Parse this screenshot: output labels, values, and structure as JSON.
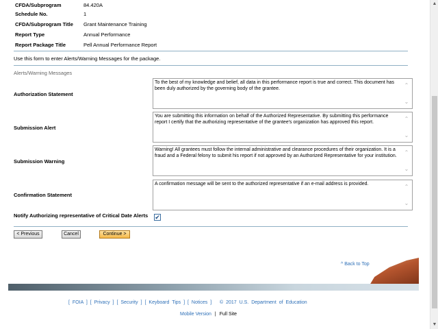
{
  "report_meta": [
    {
      "label": "CFDA/Subprogram",
      "value": "84.420A"
    },
    {
      "label": "Schedule No.",
      "value": "1"
    },
    {
      "label": "CFDA/Subprogram Title",
      "value": "Grant Maintenance Training"
    },
    {
      "label": "Report Type",
      "value": "Annual Performance"
    },
    {
      "label": "Report Package Title",
      "value": "Pell Annual Performance Report"
    }
  ],
  "instruction": "Use this form to enter Alerts/Warning Messages for the package.",
  "section_title": "Alerts/Warning Messages",
  "fields": [
    {
      "label": "Authorization Statement",
      "value": "To the best of my knowledge and belief, all data in this performance report is true and correct. This document has been duly authorized by the governing body of the grantee."
    },
    {
      "label": "Submission Alert",
      "value": "You are submitting this information on behalf of the Authorized Representative. By submitting this performance report I certify that the authorizing representative of the grantee's organization has approved this report."
    },
    {
      "label": "Submission Warning",
      "value": "Warning! All grantees must follow the internal administrative and clearance procedures of their organization. It is a fraud and a Federal felony to submit his report if not approved by an Authorized Representative for your institution."
    },
    {
      "label": "Confirmation Statement",
      "value": "A confirmation message will be sent to the authorized representative if an e-mail address is provided."
    }
  ],
  "notify": {
    "label": "Notify Authorizing representative of Critical Date Alerts",
    "checked": true,
    "check_glyph": "✔"
  },
  "buttons": {
    "previous": "< Previous",
    "cancel": "Cancel",
    "continue": "Continue >"
  },
  "back_to_top": "^ Back to Top",
  "footer": {
    "links": [
      "FOIA",
      "Privacy",
      "Security",
      "Keyboard Tips",
      "Notices"
    ],
    "copyright": "© 2017 U.S. Department of Education",
    "mobile_version": "Mobile Version",
    "full_site": "Full Site"
  },
  "scrollbar": {
    "up_glyph": "▲",
    "down_glyph": "▼"
  },
  "colors": {
    "link": "#2d6fb7",
    "divider": "#8fb0c4",
    "continue_button": "#f5b94a"
  }
}
